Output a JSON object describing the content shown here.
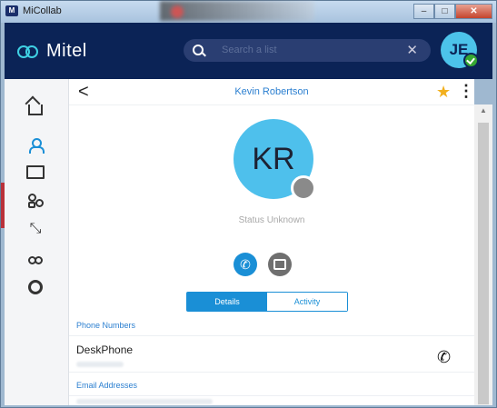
{
  "window": {
    "title": "MiCollab",
    "blurred_tab_text": "Computer side",
    "buttons": {
      "minimize": "–",
      "maximize": "□",
      "close": "✕"
    }
  },
  "header": {
    "logo": "Mitel",
    "search_placeholder": "Search a list",
    "search_clear": "✕",
    "user_initials": "JE",
    "user_presence": "available"
  },
  "sidebar": {
    "items": [
      {
        "name": "home",
        "icon": "home-icon",
        "active": false
      },
      {
        "name": "contacts",
        "icon": "person-icon",
        "active": true
      },
      {
        "name": "chat",
        "icon": "chat-icon",
        "active": false
      },
      {
        "name": "groups",
        "icon": "group-icon",
        "active": false
      },
      {
        "name": "call-history",
        "icon": "call-history-icon",
        "active": false
      },
      {
        "name": "voicemail",
        "icon": "voicemail-icon",
        "active": false
      },
      {
        "name": "settings",
        "icon": "settings-icon",
        "active": false
      }
    ]
  },
  "contact": {
    "back": "<",
    "name": "Kevin Robertson",
    "initials": "KR",
    "status": "Status Unknown",
    "favorite": "★",
    "more": "⋮",
    "tabs": [
      {
        "label": "Details",
        "active": true
      },
      {
        "label": "Activity",
        "active": false
      }
    ],
    "sections": {
      "phone_numbers_label": "Phone Numbers",
      "phone_row_label": "DeskPhone",
      "email_addresses_label": "Email Addresses"
    }
  },
  "colors": {
    "header_bg": "#0b2356",
    "accent_blue": "#1a8fd6",
    "avatar_cyan": "#4ec0ec",
    "favorite_star": "#f2b01e"
  }
}
